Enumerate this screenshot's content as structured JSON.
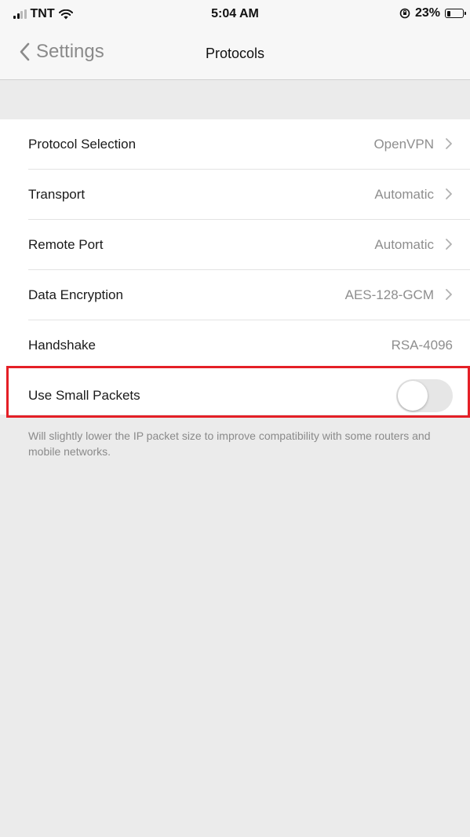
{
  "status_bar": {
    "carrier": "TNT",
    "time": "5:04 AM",
    "battery_percent": "23%",
    "battery_level": 0.23,
    "icons": [
      "signal-icon",
      "wifi-icon",
      "orientation-lock-icon",
      "battery-icon"
    ]
  },
  "nav": {
    "back_label": "Settings",
    "title": "Protocols"
  },
  "rows": [
    {
      "label": "Protocol Selection",
      "value": "OpenVPN",
      "chevron": true
    },
    {
      "label": "Transport",
      "value": "Automatic",
      "chevron": true
    },
    {
      "label": "Remote Port",
      "value": "Automatic",
      "chevron": true
    },
    {
      "label": "Data Encryption",
      "value": "AES-128-GCM",
      "chevron": true
    },
    {
      "label": "Handshake",
      "value": "RSA-4096",
      "chevron": false
    }
  ],
  "small_packets": {
    "label": "Use Small Packets",
    "enabled": false,
    "description": "Will slightly lower the IP packet size to improve compatibility with some routers and mobile networks."
  },
  "colors": {
    "highlight": "#e41f26",
    "background": "#ebebeb",
    "secondary_text": "#8e8e8e"
  }
}
